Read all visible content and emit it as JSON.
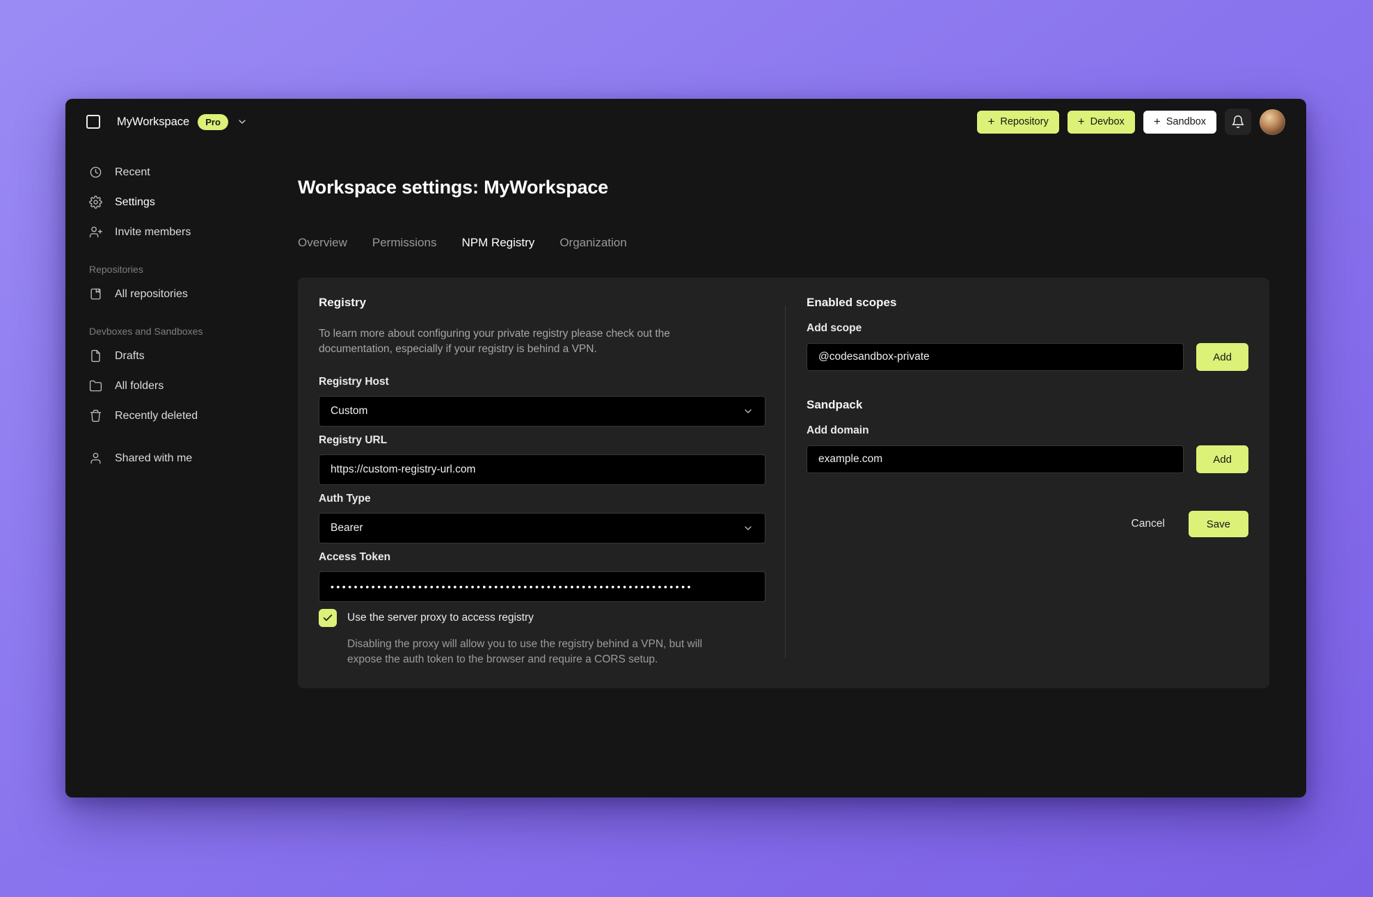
{
  "colors": {
    "accent": "#DBF178",
    "accent_text": "#161616",
    "background_top": "#9A8BF4",
    "background_bottom": "#7C60E5",
    "window_bg": "#151515",
    "panel_bg": "#222222",
    "input_bg": "#000000"
  },
  "topbar": {
    "workspace_name": "MyWorkspace",
    "plan_badge": "Pro",
    "plus_glyph": "+",
    "new_repository_label": "Repository",
    "new_devbox_label": "Devbox",
    "new_sandbox_label": "Sandbox"
  },
  "sidebar": {
    "primary": [
      {
        "label": "Recent",
        "icon": "clock-icon"
      },
      {
        "label": "Settings",
        "icon": "gear-icon"
      },
      {
        "label": "Invite members",
        "icon": "user-plus-icon"
      }
    ],
    "sections": [
      {
        "title": "Repositories",
        "items": [
          {
            "label": "All repositories",
            "icon": "repository-icon"
          }
        ]
      },
      {
        "title": "Devboxes and Sandboxes",
        "items": [
          {
            "label": "Drafts",
            "icon": "file-icon"
          },
          {
            "label": "All folders",
            "icon": "folder-icon"
          },
          {
            "label": "Recently deleted",
            "icon": "trash-icon"
          }
        ]
      }
    ],
    "shared": {
      "label": "Shared with me",
      "icon": "user-icon"
    }
  },
  "main": {
    "title": "Workspace settings: MyWorkspace",
    "tabs": [
      {
        "label": "Overview",
        "active": false
      },
      {
        "label": "Permissions",
        "active": false
      },
      {
        "label": "NPM Registry",
        "active": true
      },
      {
        "label": "Organization",
        "active": false
      }
    ],
    "registry": {
      "title": "Registry",
      "description": "To learn more about configuring your private registry please check out the documentation, especially if your registry is behind a VPN.",
      "host_label": "Registry Host",
      "host_value": "Custom",
      "url_label": "Registry URL",
      "url_value": "https://custom-registry-url.com",
      "auth_label": "Auth Type",
      "auth_value": "Bearer",
      "token_label": "Access Token",
      "token_masked": "••••••••••••••••••••••••••••••••••••••••••••••••••••••••••••••",
      "proxy_label": "Use the server proxy to access registry",
      "proxy_checked": true,
      "proxy_description": "Disabling the proxy will allow you to use the registry behind a VPN, but will expose the auth token to the browser and require a CORS setup."
    },
    "scopes": {
      "title": "Enabled scopes",
      "add_label": "Add scope",
      "input_value": "@codesandbox-private",
      "add_button_label": "Add"
    },
    "sandpack": {
      "title": "Sandpack",
      "add_label": "Add domain",
      "input_value": "example.com",
      "add_button_label": "Add"
    },
    "footer": {
      "cancel_label": "Cancel",
      "save_label": "Save"
    }
  }
}
